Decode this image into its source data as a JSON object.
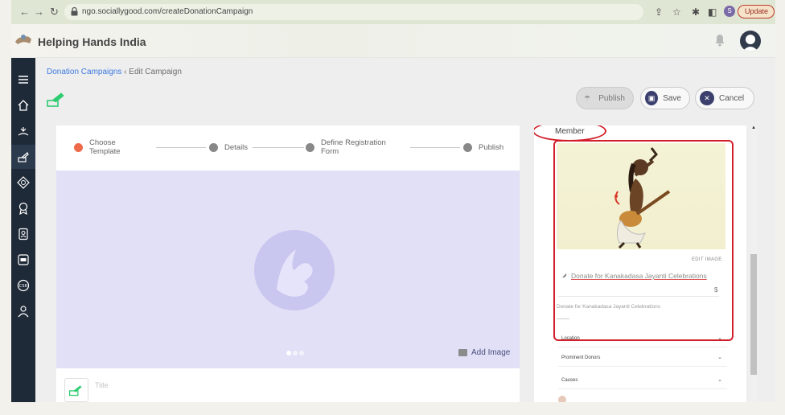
{
  "browser": {
    "url": "ngo.sociallygood.com/createDonationCampaign",
    "profile_initial": "S",
    "update_label": "Update"
  },
  "app": {
    "brand": "Helping Hands India"
  },
  "breadcrumb": {
    "parent": "Donation Campaigns",
    "separator": "‹",
    "current": "Edit Campaign"
  },
  "actions": {
    "publish": "Publish",
    "save": "Save",
    "cancel": "Cancel"
  },
  "stepper": {
    "steps": [
      {
        "label_line1": "Choose",
        "label_line2": "Template",
        "active": true
      },
      {
        "label_line1": "Details",
        "label_line2": "",
        "active": false
      },
      {
        "label_line1": "Define Registration",
        "label_line2": "Form",
        "active": false
      },
      {
        "label_line1": "Publish",
        "label_line2": "",
        "active": false
      }
    ]
  },
  "carousel": {
    "add_image": "Add Image",
    "slides": 3,
    "current": 1
  },
  "title_field": {
    "placeholder": "Title"
  },
  "preview": {
    "heading": "Member",
    "edit_image": "EDIT IMAGE",
    "donate_title": "Donate for Kanakadasa Jayanti Celebrations",
    "currency": "$",
    "description": "Donate for Kanakadasa Jayanti Celebrations",
    "dropdowns": [
      "Location",
      "Prominent Donors",
      "Causes"
    ]
  },
  "colors": {
    "sidebar": "#1f2a38",
    "accent_green": "#2ecc71",
    "step_active": "#ef6a4b",
    "highlight_red": "#d21f2a",
    "button_navy": "#3b3f6e"
  },
  "icons": {
    "sidebar": [
      "menu-icon",
      "home-icon",
      "donate-hand-icon",
      "campaign-icon",
      "badge-icon",
      "award-icon",
      "contacts-icon",
      "ngo-icon",
      "csr-icon",
      "users-icon"
    ]
  }
}
